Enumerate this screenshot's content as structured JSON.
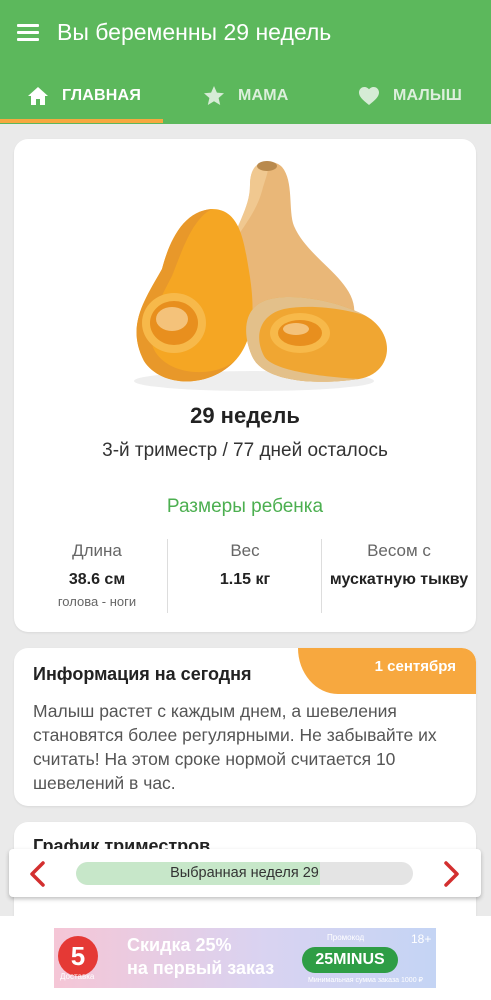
{
  "app_bar": {
    "title": "Вы беременны 29 недель",
    "menu_icon": "hamburger-menu-icon"
  },
  "tabs": [
    {
      "label": "ГЛАВНАЯ",
      "icon": "home-icon",
      "selected": true
    },
    {
      "label": "МАМА",
      "icon": "star-icon",
      "selected": false
    },
    {
      "label": "МАЛЫШ",
      "icon": "heart-icon",
      "selected": false
    }
  ],
  "colors": {
    "primary_green": "#5cb85c",
    "accent_orange": "#f7a83f",
    "link_green": "#4caf50",
    "arrow_red": "#d32f2f"
  },
  "overview": {
    "image": "butternut-squash-image",
    "weeks": "29 недель",
    "trimester": "3-й триместр / 77 дней осталось",
    "sizes_link": "Размеры ребенка",
    "stats": [
      {
        "heading": "Длина",
        "value": "38.6 см",
        "sub": "голова - ноги"
      },
      {
        "heading": "Вес",
        "value": "1.15 кг",
        "sub": ""
      },
      {
        "heading": "Весом с",
        "value": "мускатную тыкву",
        "sub": ""
      }
    ]
  },
  "info": {
    "title": "Информация на сегодня",
    "date": "1 сентября",
    "body": "Малыш растет с каждым днем, а шевеления становятся более регулярными. Не забывайте их считать! На этом сроке нормой считается 10 шевелений в час."
  },
  "graph_card": {
    "title": "График триместров"
  },
  "week_selector": {
    "label": "Выбранная неделя 29",
    "selected_week": 29,
    "total_weeks": 40,
    "progress_fraction": 0.725
  },
  "ad": {
    "logo_text": "5",
    "logo_sub": "Доставка",
    "line1": "Скидка 25%",
    "line2": "на первый заказ",
    "promo_label": "Промокод",
    "promo_code": "25MINUS",
    "age_rating": "18+",
    "min_order": "Минимальная сумма заказа 1000 ₽"
  }
}
